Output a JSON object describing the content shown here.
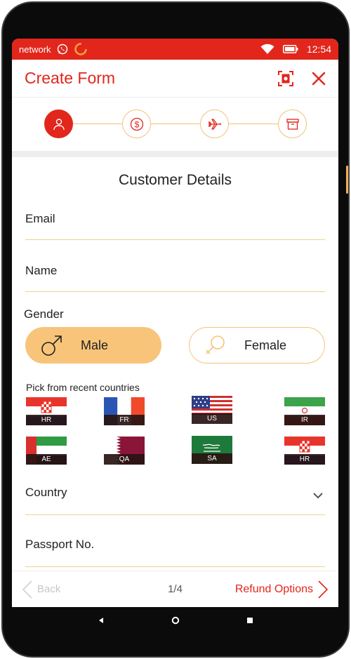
{
  "status_bar": {
    "carrier": "network",
    "time": "12:54",
    "icons": [
      "whatsapp-icon",
      "loading-ring-icon",
      "wifi-icon",
      "battery-icon"
    ]
  },
  "header": {
    "title": "Create Form",
    "actions": [
      "scan-icon",
      "close-icon"
    ]
  },
  "stepper": {
    "steps": [
      {
        "icon": "person-icon",
        "active": true
      },
      {
        "icon": "dollar-icon",
        "active": false
      },
      {
        "icon": "airplane-icon",
        "active": false
      },
      {
        "icon": "archive-box-icon",
        "active": false
      }
    ]
  },
  "form": {
    "section_title": "Customer Details",
    "email_label": "Email",
    "name_label": "Name",
    "gender_label": "Gender",
    "gender_options": [
      {
        "label": "Male",
        "icon": "male-symbol-icon",
        "selected": true
      },
      {
        "label": "Female",
        "icon": "female-symbol-icon",
        "selected": false
      }
    ],
    "recent_countries_label": "Pick from recent countries",
    "recent_countries": [
      {
        "code": "HR"
      },
      {
        "code": "FR"
      },
      {
        "code": "US"
      },
      {
        "code": "IR"
      },
      {
        "code": "AE"
      },
      {
        "code": "QA"
      },
      {
        "code": "SA"
      },
      {
        "code": "HR"
      }
    ],
    "country_label": "Country",
    "passport_label": "Passport No."
  },
  "footer": {
    "back_label": "Back",
    "page_indicator": "1/4",
    "next_label": "Refund Options"
  },
  "colors": {
    "brand_red": "#e2261c",
    "accent_orange": "#f8c47a",
    "line_orange": "#f2cf8f"
  }
}
